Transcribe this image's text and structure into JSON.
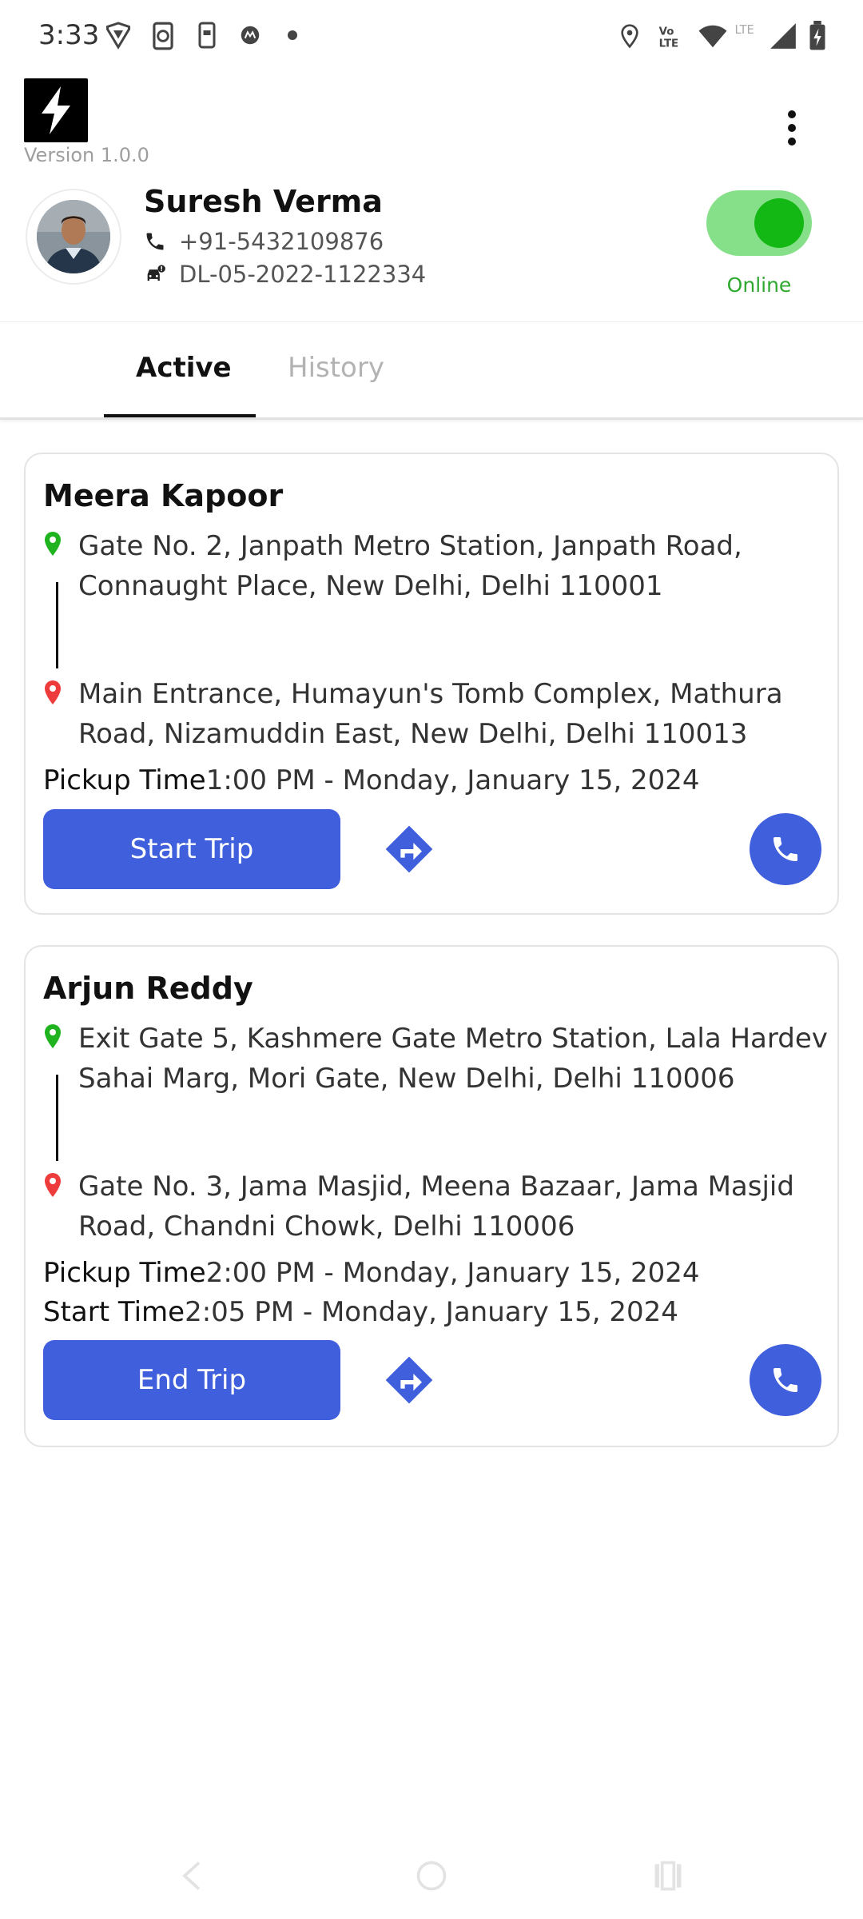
{
  "status_bar": {
    "time": "3:33",
    "icons": [
      "vpn-icon",
      "sync-icon",
      "sim-icon",
      "motorola-icon",
      "dot-icon",
      "location-icon",
      "volte-icon",
      "wifi-icon",
      "lte-icon",
      "signal-icon",
      "battery-icon"
    ]
  },
  "app": {
    "logo": "lightning-bolt-logo",
    "version": "Version 1.0.0",
    "menu_icon": "more-vertical-icon"
  },
  "profile": {
    "name": "Suresh Verma",
    "phone": "+91-5432109876",
    "license": "DL-05-2022-1122334",
    "status_label": "Online",
    "online": true,
    "toggle_color": "#14b814"
  },
  "tabs": [
    {
      "label": "Active",
      "selected": true
    },
    {
      "label": "History",
      "selected": false
    }
  ],
  "trips": [
    {
      "passenger": "Meera Kapoor",
      "pickup": "Gate No. 2, Janpath Metro Station, Janpath Road, Connaught Place, New Delhi, Delhi 110001",
      "dropoff": "Main Entrance, Humayun's Tomb Complex, Mathura Road, Nizamuddin East, New Delhi, Delhi 110013",
      "pickup_time_label": "Pickup Time",
      "pickup_time": "1:00 PM - Monday, January 15, 2024",
      "action_label": "Start Trip"
    },
    {
      "passenger": "Arjun Reddy",
      "pickup": "Exit Gate 5, Kashmere Gate Metro Station, Lala Hardev Sahai Marg, Mori Gate, New Delhi, Delhi 110006",
      "dropoff": "Gate No. 3, Jama Masjid, Meena Bazaar, Jama Masjid Road, Chandni Chowk, Delhi 110006",
      "pickup_time_label": "Pickup Time",
      "pickup_time": "2:00 PM - Monday, January 15, 2024",
      "start_time_label": "Start Time",
      "start_time": "2:05 PM - Monday, January 15, 2024",
      "action_label": "End Trip"
    }
  ],
  "colors": {
    "accent": "#3f5fdd",
    "pickup_pin": "#1fb31f",
    "dropoff_pin": "#ee3b3b"
  }
}
